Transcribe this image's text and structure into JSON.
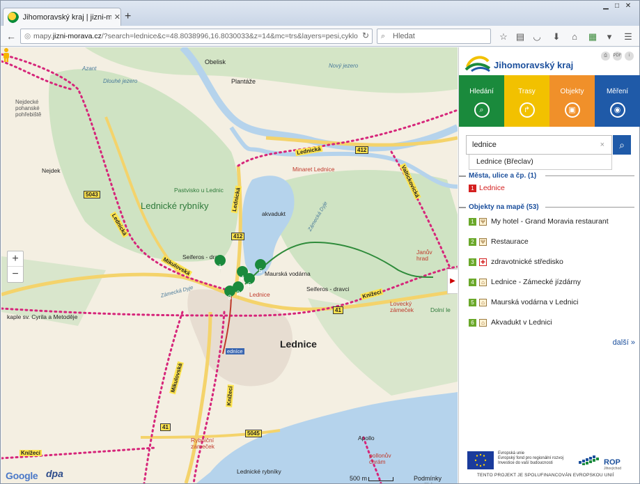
{
  "browser": {
    "tab_title": "Jihomoravský kraj | jizni-mora...",
    "url_prefix": "mapy.",
    "url_host": "jizni-morava.cz",
    "url_rest": "/?search=lednice&c=48.8038996,16.8030033&z=14&mc=trs&layers=pesi,cyklo",
    "search_placeholder": "Hledat"
  },
  "panel": {
    "logo_text": "Jihomoravský kraj",
    "tools": [
      "print-icon",
      "pdf-icon",
      "info-icon"
    ],
    "tool_labels": [
      "⎙",
      "PDF",
      "i"
    ],
    "tabs": [
      {
        "label": "Hledání",
        "color": "#1a8a3c",
        "icon": "search-icon",
        "glyph": "⌕"
      },
      {
        "label": "Trasy",
        "color": "#f2c100",
        "icon": "route-icon",
        "glyph": "↱"
      },
      {
        "label": "Objekty",
        "color": "#f0902a",
        "icon": "building-icon",
        "glyph": "▣"
      },
      {
        "label": "Měření",
        "color": "#1f5aa8",
        "icon": "pin-icon",
        "glyph": "◉"
      }
    ],
    "search_value": "lednice",
    "suggestion": "Lednice (Břeclav)",
    "section_towns": "Města, ulice a čp. (1)",
    "towns": [
      {
        "num": "1",
        "label": "Lednice"
      }
    ],
    "section_objects": "Objekty na mapě (53)",
    "objects": [
      {
        "num": "1",
        "icon": "restaurant-icon",
        "glyph": "Ψ",
        "label": "My hotel - Grand Moravia restaurant"
      },
      {
        "num": "2",
        "icon": "restaurant-icon",
        "glyph": "Ψ",
        "label": "Restaurace"
      },
      {
        "num": "3",
        "icon": "health-icon",
        "glyph": "✚",
        "label": "zdravotnické středisko"
      },
      {
        "num": "4",
        "icon": "monument-icon",
        "glyph": "⌂",
        "label": "Lednice - Zámecké jízdárny"
      },
      {
        "num": "5",
        "icon": "monument-icon",
        "glyph": "⌂",
        "label": "Maurská vodárna v Lednici"
      },
      {
        "num": "6",
        "icon": "monument-icon",
        "glyph": "⌂",
        "label": "Akvadukt v Lednici"
      }
    ],
    "more_label": "další",
    "eu_text": [
      "Evropská unie",
      "Evropský fond pro regionální rozvoj",
      "Investice do vaší budoucnosti"
    ],
    "rop_label": "ROP",
    "rop_sub": "Jihovýchod",
    "eu_footer": "TENTO PROJEKT JE SPOLUFINANCOVÁN EVROPSKOU UNIÍ"
  },
  "map": {
    "labels": {
      "obelisk": "Obelisk",
      "plantaze": "Plantáže",
      "azant": "Azant",
      "novy_jezero": "Nový jezero",
      "dlouhe_jezero": "Dlouhé jezero",
      "pohrebiste": "Nejdecké\npohanské\npohřebiště",
      "nejdek": "Nejdek",
      "pastvisko": "Pastvisko u Lednic",
      "minaret": "Minaret Lednice",
      "lednicke_rybniky": "Lednické rybníky",
      "akvadukt": "akvadukt",
      "zamecky_dyje": "Zámecká Dyje",
      "seiferos": "Seiferos - dravc",
      "maurska": "Maurská vodárna",
      "seiferos2": "Seiferos - dravci",
      "januv_hrad": "Janův\nhrad",
      "lovecky": "Lovecký\nzámeček",
      "dolni": "Dolní le",
      "kaple": "kaple sv. Cyrila a Metoděje",
      "zamecka_dyje2": "Zámecká Dyje",
      "lednice_place": "Lednice",
      "lednice_red": "Lednice",
      "lednice_small": "edníce",
      "rybnicni": "Rybniční\nzámeček",
      "apollo": "Apollo",
      "pollonuv": "pollonův\nchrám",
      "lednicke_rybniky2": "Lednické rybníky"
    },
    "roads": [
      {
        "id": "r412a",
        "label": "412"
      },
      {
        "id": "r412b",
        "label": "412"
      },
      {
        "id": "r5043",
        "label": "5043"
      },
      {
        "id": "r41a",
        "label": "41"
      },
      {
        "id": "r41b",
        "label": "41"
      },
      {
        "id": "r5045",
        "label": "5045"
      }
    ],
    "trails": [
      {
        "id": "lednicka",
        "label": "Lednická"
      },
      {
        "id": "lednicka2",
        "label": "Lednická"
      },
      {
        "id": "valtice",
        "label": "Valtickovická"
      },
      {
        "id": "mikulovska",
        "label": "Mikulovská"
      },
      {
        "id": "mikulovska2",
        "label": "Mikulovská"
      },
      {
        "id": "knizeci",
        "label": "Knížecí"
      },
      {
        "id": "knizeci2",
        "label": "Knížecí"
      },
      {
        "id": "knizeci3",
        "label": "Knížecí"
      },
      {
        "id": "lednicka3",
        "label": "Lednická"
      }
    ],
    "markers": [
      "1",
      "2",
      "3",
      "4",
      "5",
      "6"
    ],
    "zoom_in": "+",
    "zoom_out": "−",
    "google": "Google",
    "dpa": "dpa",
    "scale": "500 m",
    "terms": "Podmínky použití"
  }
}
